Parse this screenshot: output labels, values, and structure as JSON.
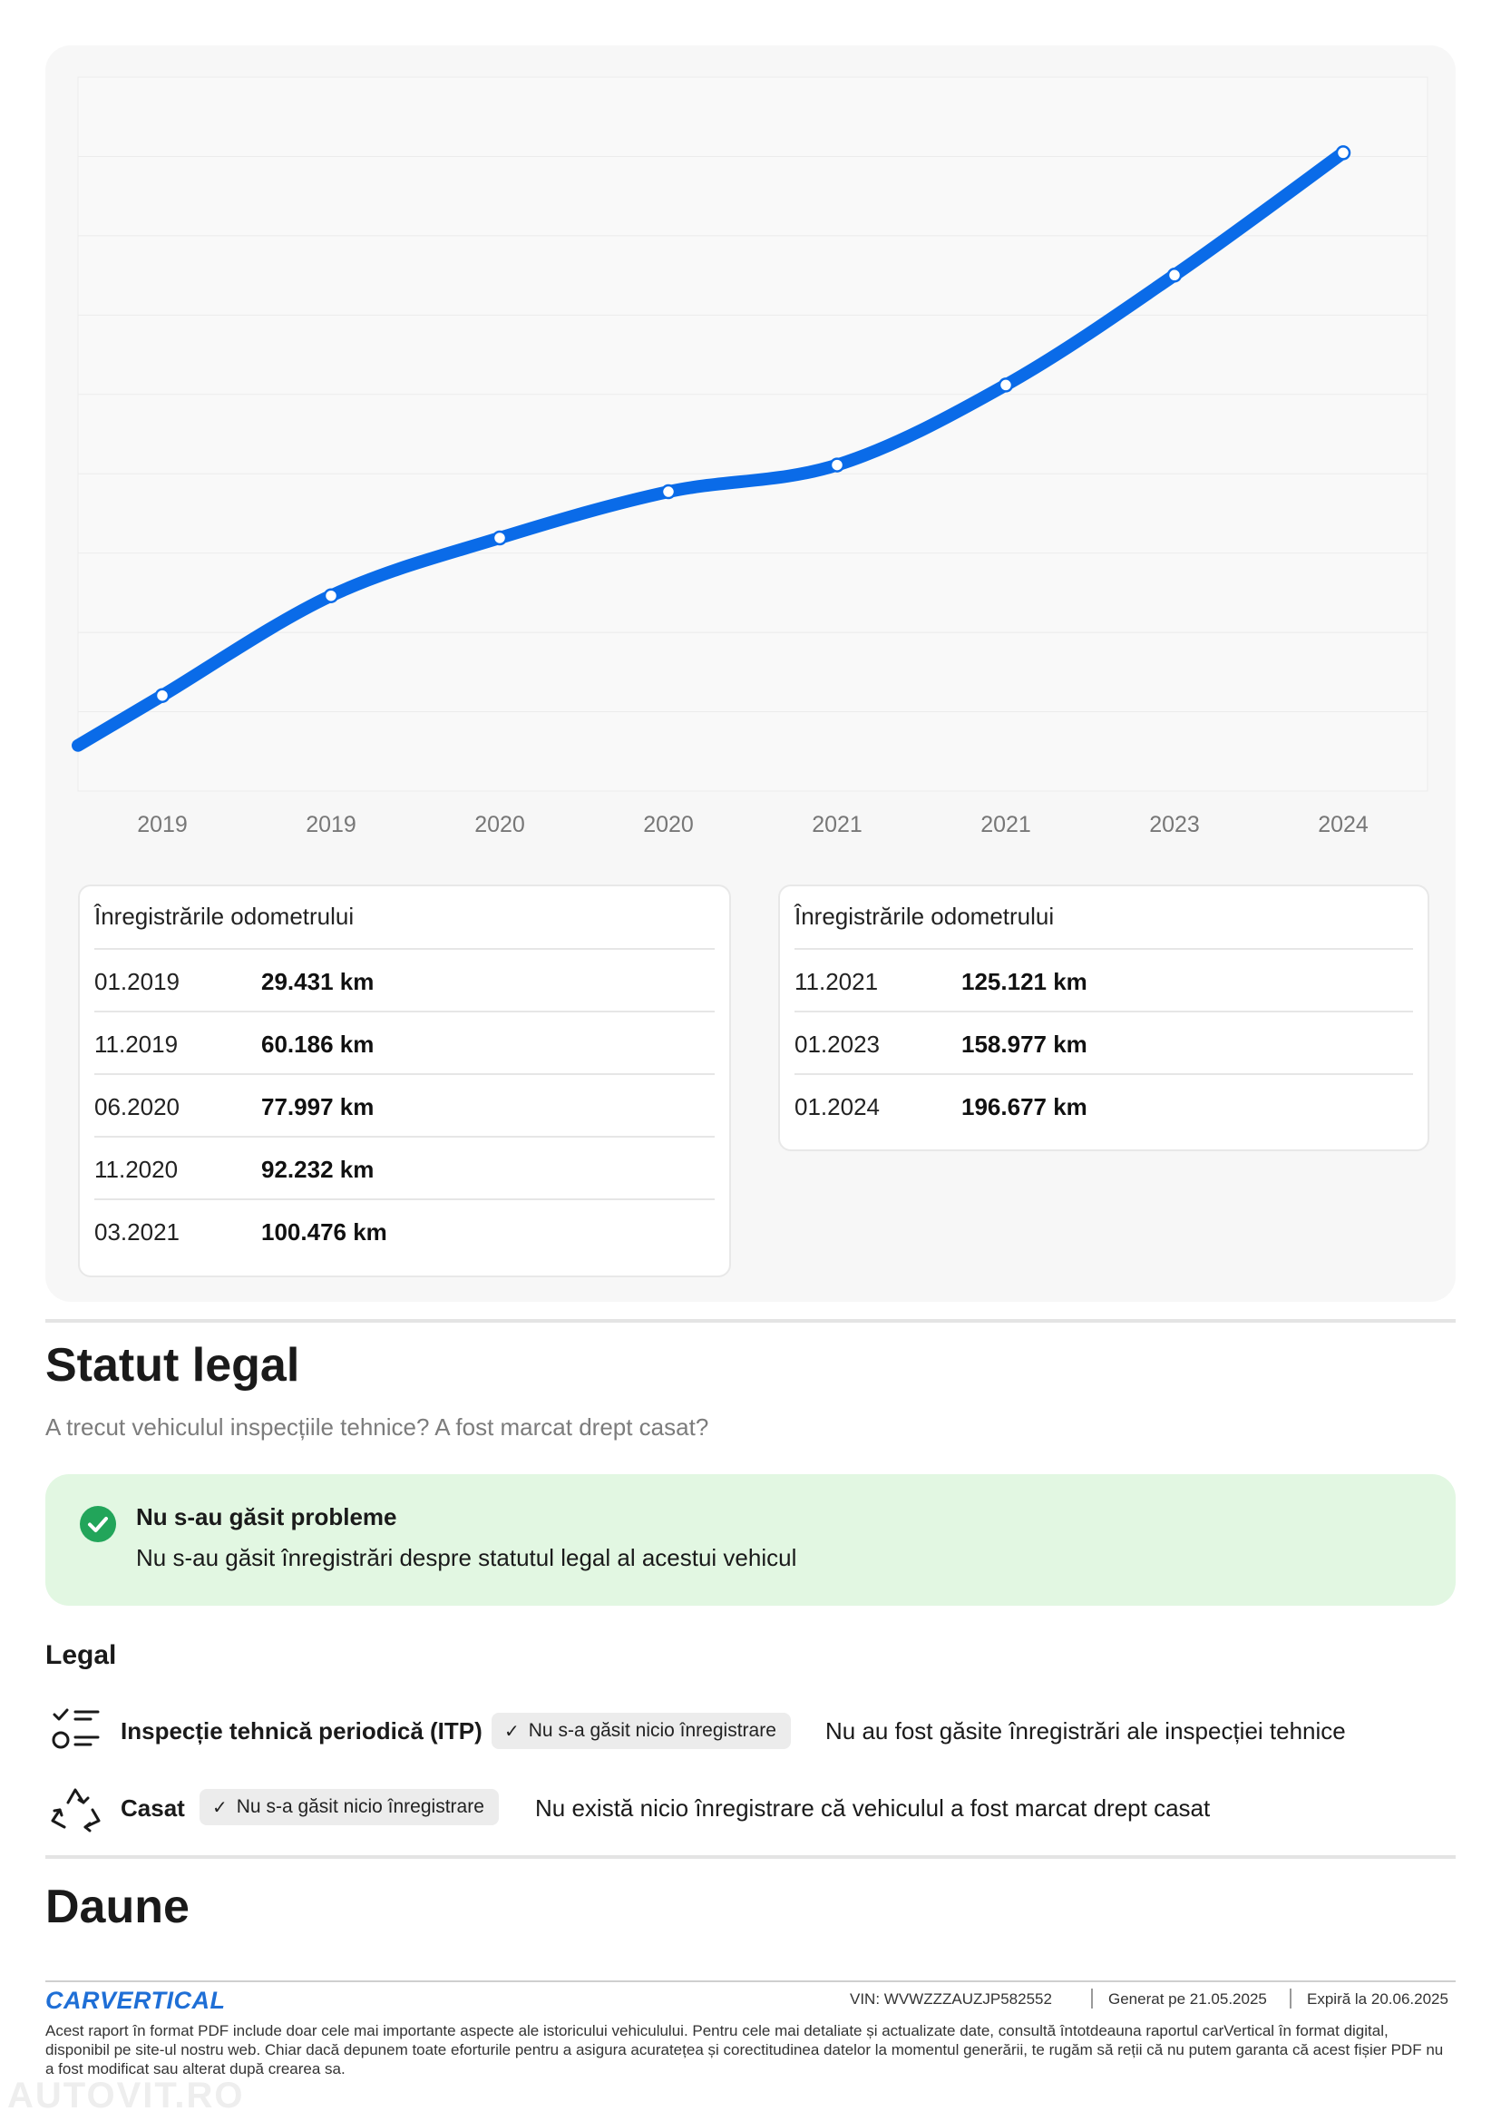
{
  "chart_data": {
    "type": "line",
    "series": [
      {
        "dates": [
          "01.2019",
          "11.2019",
          "06.2020",
          "11.2020",
          "03.2021",
          "11.2021",
          "01.2023",
          "01.2024"
        ],
        "values": [
          29431,
          60186,
          77997,
          92232,
          100476,
          125121,
          158977,
          196677
        ]
      }
    ],
    "x_tick_labels": [
      "2019",
      "2019",
      "2020",
      "2020",
      "2021",
      "2021",
      "2023",
      "2024"
    ],
    "ylabel": "",
    "ylim": [
      0,
      220000
    ],
    "unit": "km",
    "line_color": "#0a6be8",
    "grid": true
  },
  "odometer": {
    "left": {
      "title": "Înregistrările odometrului",
      "rows": [
        {
          "date": "01.2019",
          "value": "29.431 km"
        },
        {
          "date": "11.2019",
          "value": "60.186 km"
        },
        {
          "date": "06.2020",
          "value": "77.997 km"
        },
        {
          "date": "11.2020",
          "value": "92.232 km"
        },
        {
          "date": "03.2021",
          "value": "100.476 km"
        }
      ]
    },
    "right": {
      "title": "Înregistrările odometrului",
      "rows": [
        {
          "date": "11.2021",
          "value": "125.121 km"
        },
        {
          "date": "01.2023",
          "value": "158.977 km"
        },
        {
          "date": "01.2024",
          "value": "196.677 km"
        }
      ]
    }
  },
  "legal": {
    "title": "Statut legal",
    "subtitle": "A trecut vehiculul inspecțiile tehnice? A fost marcat drept casat?",
    "status_title": "Nu s-au găsit probleme",
    "status_text": "Nu s-au găsit înregistrări despre statutul legal al acestui vehicul",
    "section_label": "Legal",
    "items": [
      {
        "icon": "checklist-icon",
        "label": "Inspecție tehnică periodică (ITP)",
        "chip": "Nu s-a găsit nicio înregistrare",
        "description": "Nu au fost găsite înregistrări ale inspecției tehnice"
      },
      {
        "icon": "recycle-icon",
        "label": "Casat",
        "chip": "Nu s-a găsit nicio înregistrare",
        "description": "Nu există nicio înregistrare că vehiculul a fost marcat drept casat"
      }
    ]
  },
  "damage": {
    "title": "Daune"
  },
  "footer": {
    "logo": "CARVERTICAL",
    "vin_label": "VIN:",
    "vin": "WVWZZZAUZJP582552",
    "generated_label": "Generat pe",
    "generated": "21.05.2025",
    "expires_label": "Expiră la",
    "expires": "20.06.2025",
    "disclaimer": "Acest raport în format PDF include doar cele mai importante aspecte ale istoricului vehiculului. Pentru cele mai detaliate și actualizate date, consultă întotdeauna raportul carVertical în format digital, disponibil pe site-ul nostru web. Chiar dacă depunem toate eforturile pentru a asigura acuratețea și corectitudinea datelor la momentul generării, te rugăm să reții că nu putem garanta că acest fișier PDF nu a fost modificat sau alterat după crearea sa.",
    "watermark": "AUTOVIT.RO"
  },
  "colors": {
    "accent": "#0a6be8",
    "success": "#22a55a",
    "success_bg": "#e2f7e2",
    "brand": "#1f6fd6"
  }
}
